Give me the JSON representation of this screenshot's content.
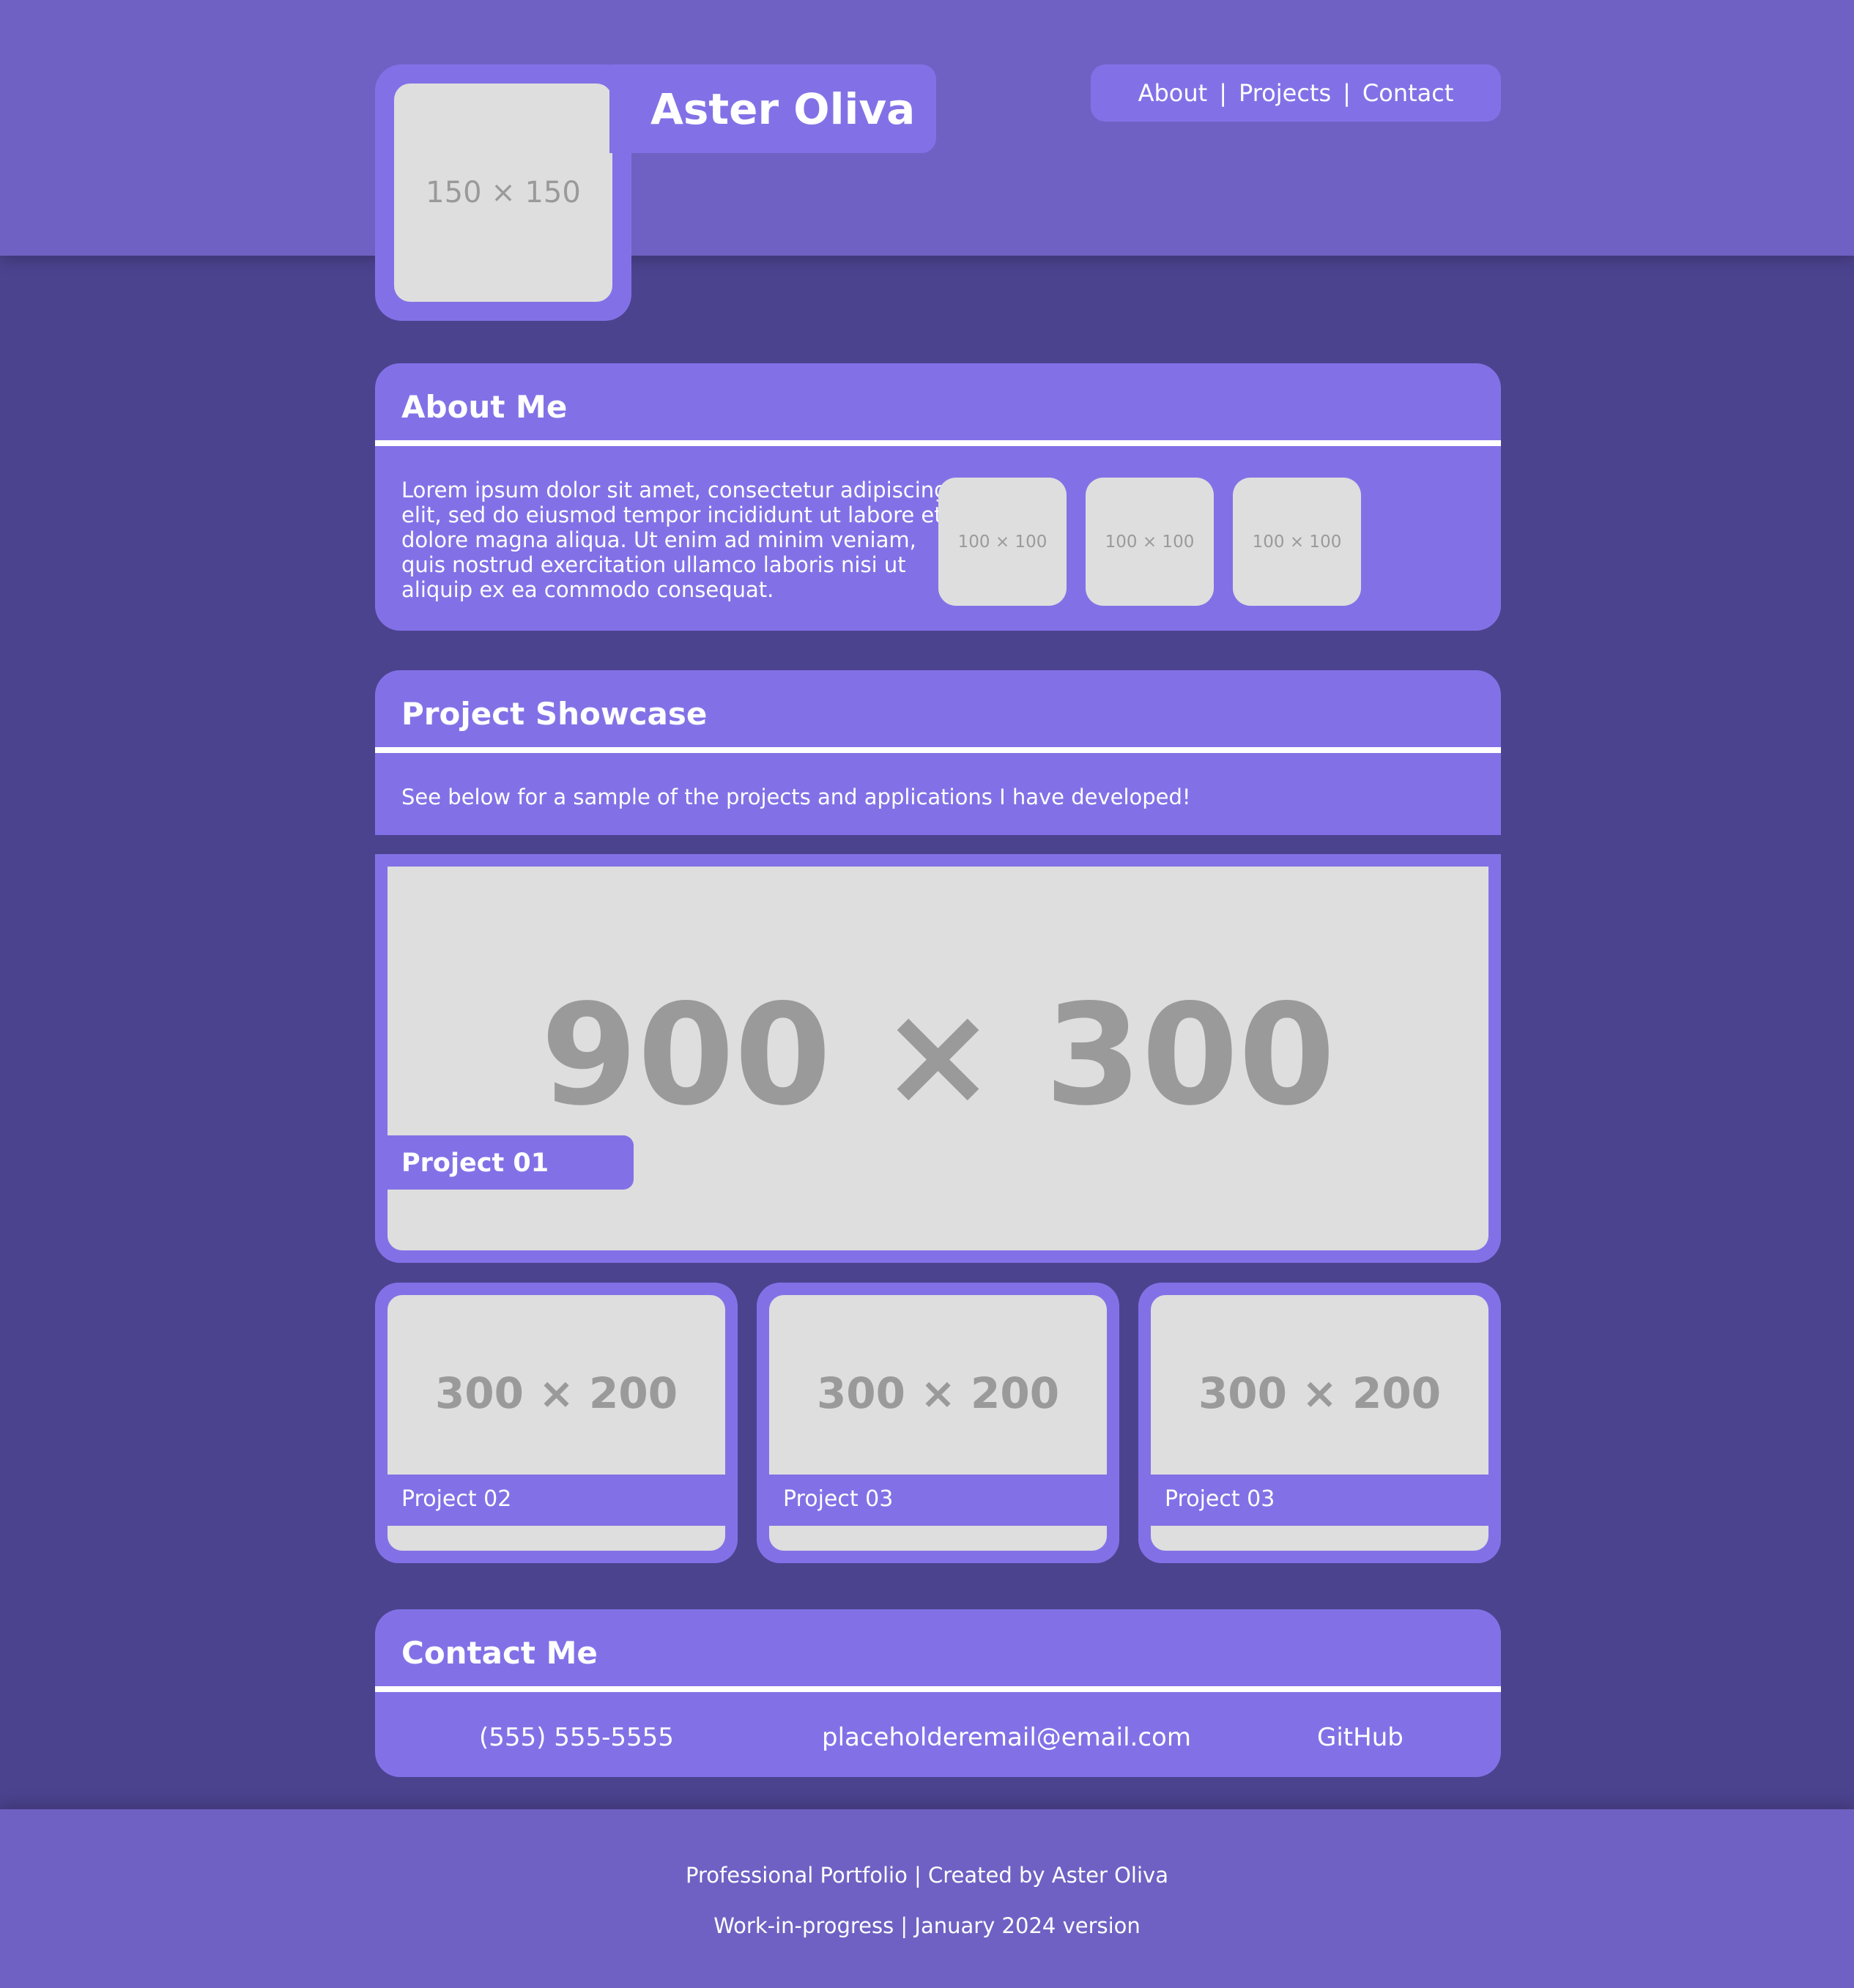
{
  "header": {
    "name": "Aster Oliva",
    "avatar_label": "150 × 150",
    "nav": [
      {
        "label": "About"
      },
      {
        "label": "Projects"
      },
      {
        "label": "Contact"
      }
    ],
    "nav_separator": "|"
  },
  "about": {
    "title": "About Me",
    "body_lines": [
      "Lorem ipsum dolor sit amet, consectetur adipiscing",
      "elit, sed do eiusmod tempor incididunt ut labore et",
      "dolore magna aliqua. Ut enim ad minim veniam,",
      "quis nostrud exercitation ullamco laboris nisi ut",
      "aliquip ex ea commodo consequat."
    ],
    "thumbnails": [
      "100 × 100",
      "100 × 100",
      "100 × 100"
    ]
  },
  "projects": {
    "title": "Project Showcase",
    "intro": "See below for a sample of the projects and applications I have developed!",
    "featured": {
      "image_label": "900 × 300",
      "caption": "Project 01"
    },
    "cards": [
      {
        "image_label": "300 × 200",
        "caption": "Project 02"
      },
      {
        "image_label": "300 × 200",
        "caption": "Project 03"
      },
      {
        "image_label": "300 × 200",
        "caption": "Project 03"
      }
    ]
  },
  "contact": {
    "title": "Contact Me",
    "phone": "(555) 555-5555",
    "email": "placeholderemail@email.com",
    "github": "GitHub"
  },
  "footer": {
    "line1": "Professional Portfolio | Created by Aster Oliva",
    "line2": "Work-in-progress | January 2024 version"
  },
  "colors": {
    "page_background": "#4c438f",
    "header_footer": "#6f61c3",
    "panel": "#8271e6",
    "placeholder": "#dedede",
    "placeholder_text": "#9a9a9a",
    "text": "#ffffff"
  }
}
